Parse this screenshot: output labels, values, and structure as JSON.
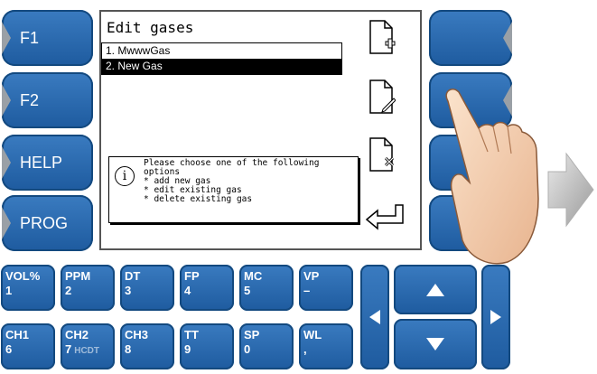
{
  "screen": {
    "title": "Edit gases",
    "list": [
      {
        "label": "1.  MwwwGas",
        "selected": false
      },
      {
        "label": "2.  New Gas",
        "selected": true
      }
    ],
    "info_lines": "Please choose one of the following\noptions\n* add new gas\n* edit existing gas\n* delete existing gas"
  },
  "function_keys": [
    {
      "label": "F1"
    },
    {
      "label": "F2"
    },
    {
      "label": "HELP"
    },
    {
      "label": "PROG"
    }
  ],
  "keypad": [
    {
      "top": "VOL%",
      "bottom": "1"
    },
    {
      "top": "PPM",
      "bottom": "2"
    },
    {
      "top": "DT",
      "bottom": "3"
    },
    {
      "top": "FP",
      "bottom": "4"
    },
    {
      "top": "MC",
      "bottom": "5"
    },
    {
      "top": "VP",
      "bottom": "–"
    },
    {
      "top": "CH1",
      "bottom": "6"
    },
    {
      "top": "CH2",
      "bottom": "7",
      "extra": "HCDT"
    },
    {
      "top": "CH3",
      "bottom": "8"
    },
    {
      "top": "TT",
      "bottom": "9"
    },
    {
      "top": "SP",
      "bottom": "0"
    },
    {
      "top": "WL",
      "bottom": ","
    }
  ],
  "icons": {
    "add": "file-add-icon",
    "edit": "file-edit-icon",
    "delete": "file-delete-icon",
    "back": "return-arrow-icon",
    "info": "info-icon"
  },
  "colors": {
    "key_blue": "#2a6aad",
    "selected_row": "#000000"
  }
}
